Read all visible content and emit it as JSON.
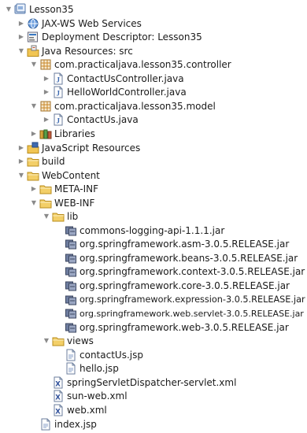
{
  "tree": [
    {
      "label": "Lesson35",
      "icon": "project-icon",
      "state": "expanded",
      "level": 0
    },
    {
      "label": "JAX-WS Web Services",
      "icon": "webservices-icon",
      "state": "collapsed",
      "level": 1
    },
    {
      "label": "Deployment Descriptor: Lesson35",
      "icon": "deployment-descriptor-icon",
      "state": "collapsed",
      "level": 1
    },
    {
      "label": "Java Resources: src",
      "icon": "java-resources-icon",
      "state": "expanded",
      "level": 1
    },
    {
      "label": "com.practicaljava.lesson35.controller",
      "icon": "package-icon",
      "state": "expanded",
      "level": 2
    },
    {
      "label": "ContactUsController.java",
      "icon": "java-file-icon",
      "state": "collapsed",
      "level": 3
    },
    {
      "label": "HelloWorldController.java",
      "icon": "java-file-icon",
      "state": "collapsed",
      "level": 3
    },
    {
      "label": "com.practicaljava.lesson35.model",
      "icon": "package-icon",
      "state": "expanded",
      "level": 2
    },
    {
      "label": "ContactUs.java",
      "icon": "java-file-icon",
      "state": "collapsed",
      "level": 3
    },
    {
      "label": "Libraries",
      "icon": "library-icon",
      "state": "collapsed",
      "level": 2
    },
    {
      "label": "JavaScript Resources",
      "icon": "javascript-resources-icon",
      "state": "collapsed",
      "level": 1
    },
    {
      "label": "build",
      "icon": "folder-icon",
      "state": "collapsed",
      "level": 1
    },
    {
      "label": "WebContent",
      "icon": "folder-icon",
      "state": "expanded",
      "level": 1
    },
    {
      "label": "META-INF",
      "icon": "folder-icon",
      "state": "collapsed",
      "level": 2
    },
    {
      "label": "WEB-INF",
      "icon": "folder-icon",
      "state": "expanded",
      "level": 2
    },
    {
      "label": "lib",
      "icon": "folder-icon",
      "state": "expanded",
      "level": 3
    },
    {
      "label": "commons-logging-api-1.1.1.jar",
      "icon": "jar-icon",
      "state": "leaf",
      "level": 4
    },
    {
      "label": "org.springframework.asm-3.0.5.RELEASE.jar",
      "icon": "jar-icon",
      "state": "leaf",
      "level": 4
    },
    {
      "label": "org.springframework.beans-3.0.5.RELEASE.jar",
      "icon": "jar-icon",
      "state": "leaf",
      "level": 4
    },
    {
      "label": "org.springframework.context-3.0.5.RELEASE.jar",
      "icon": "jar-icon",
      "state": "leaf",
      "level": 4
    },
    {
      "label": "org.springframework.core-3.0.5.RELEASE.jar",
      "icon": "jar-icon",
      "state": "leaf",
      "level": 4
    },
    {
      "label": "org.springframework.expression-3.0.5.RELEASE.jar",
      "icon": "jar-icon",
      "state": "leaf",
      "level": 4
    },
    {
      "label": "org.springframework.web.servlet-3.0.5.RELEASE.jar",
      "icon": "jar-icon",
      "state": "leaf",
      "level": 4
    },
    {
      "label": "org.springframework.web-3.0.5.RELEASE.jar",
      "icon": "jar-icon",
      "state": "leaf",
      "level": 4
    },
    {
      "label": "views",
      "icon": "folder-icon",
      "state": "expanded",
      "level": 3
    },
    {
      "label": "contactUs.jsp",
      "icon": "jsp-file-icon",
      "state": "leaf",
      "level": 4
    },
    {
      "label": "hello.jsp",
      "icon": "jsp-file-icon",
      "state": "leaf",
      "level": 4
    },
    {
      "label": "springServletDispatcher-servlet.xml",
      "icon": "xml-file-icon",
      "state": "leaf",
      "level": 3
    },
    {
      "label": "sun-web.xml",
      "icon": "xml-file-icon",
      "state": "leaf",
      "level": 3
    },
    {
      "label": "web.xml",
      "icon": "xml-file-icon",
      "state": "leaf",
      "level": 3
    },
    {
      "label": "index.jsp",
      "icon": "jsp-file-icon",
      "state": "leaf",
      "level": 2
    }
  ]
}
